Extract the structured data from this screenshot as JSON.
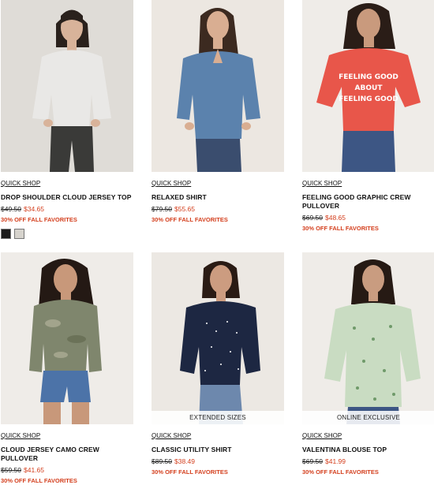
{
  "products": [
    {
      "quick_shop": "QUICK SHOP",
      "name": "DROP SHOULDER CLOUD JERSEY TOP",
      "original_price": "$49.50",
      "sale_price": "$34.65",
      "promo": "30% OFF FALL FAVORITES",
      "swatches": [
        "#1a1a1a",
        "#d6d3cd"
      ],
      "badge": ""
    },
    {
      "quick_shop": "QUICK SHOP",
      "name": "RELAXED SHIRT",
      "original_price": "$79.50",
      "sale_price": "$55.65",
      "promo": "30% OFF FALL FAVORITES",
      "badge": ""
    },
    {
      "quick_shop": "QUICK SHOP",
      "name": "FEELING GOOD GRAPHIC CREW PULLOVER",
      "original_price": "$69.50",
      "sale_price": "$48.65",
      "promo": "30% OFF FALL FAVORITES",
      "badge": "",
      "graphic_text": [
        "FEELING GOOD",
        "ABOUT",
        "FEELING GOOD"
      ]
    },
    {
      "quick_shop": "QUICK SHOP",
      "name": "CLOUD JERSEY CAMO CREW PULLOVER",
      "original_price": "$59.50",
      "sale_price": "$41.65",
      "promo": "30% OFF FALL FAVORITES",
      "badge": ""
    },
    {
      "quick_shop": "QUICK SHOP",
      "name": "CLASSIC UTILITY SHIRT",
      "original_price": "$89.50",
      "sale_price": "$38.49",
      "promo": "30% OFF FALL FAVORITES",
      "badge": "EXTENDED SIZES"
    },
    {
      "quick_shop": "QUICK SHOP",
      "name": "VALENTINA BLOUSE TOP",
      "original_price": "$69.50",
      "sale_price": "$41.99",
      "promo": "30% OFF FALL FAVORITES",
      "badge": "ONLINE EXCLUSIVE"
    }
  ],
  "colors": {
    "sale": "#d4401f",
    "promo": "#d4401f"
  }
}
